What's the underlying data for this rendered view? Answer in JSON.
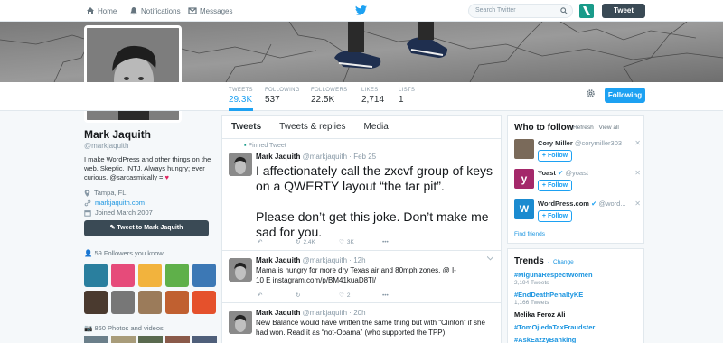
{
  "nav": {
    "home": "Home",
    "notifications": "Notifications",
    "messages": "Messages",
    "search_placeholder": "Search Twitter",
    "tweet": "Tweet"
  },
  "stats": [
    {
      "label": "TWEETS",
      "value": "29.3K"
    },
    {
      "label": "FOLLOWING",
      "value": "537"
    },
    {
      "label": "FOLLOWERS",
      "value": "22.5K"
    },
    {
      "label": "LIKES",
      "value": "2,714"
    },
    {
      "label": "LISTS",
      "value": "1"
    }
  ],
  "following_button": "Following",
  "profile": {
    "name": "Mark Jaquith",
    "handle": "@markjaquith",
    "bio": "I make WordPress and other things on the web. Skeptic. INTJ. Always hungry; ever curious. @sarcasmically =",
    "location": "Tampa, FL",
    "website": "markjaquith.com",
    "joined": "Joined March 2007",
    "tweet_to": "Tweet to Mark Jaquith",
    "followers_you_know": "59 Followers you know",
    "photos_videos": "860 Photos and videos"
  },
  "timeline": {
    "tabs": [
      "Tweets",
      "Tweets & replies",
      "Media"
    ],
    "tweets": [
      {
        "pinned_label": "Pinned Tweet",
        "name": "Mark Jaquith",
        "handle": "@markjaquith",
        "time": "Feb 25",
        "text1": "I affectionately call the zxcvf group of keys on a QWERTY layout “the tar pit”.",
        "text2": "Please don’t get this joke. Don’t make me sad for you.",
        "retweets": "2.4K",
        "likes": "3K"
      },
      {
        "name": "Mark Jaquith",
        "handle": "@markjaquith",
        "time": "12h",
        "text": "Mama is hungry for more dry Texas air and 80mph zones. @ I-10 E instagram.com/p/BM41kuaD8Tl/",
        "retweets": "",
        "likes": "2"
      },
      {
        "name": "Mark Jaquith",
        "handle": "@markjaquith",
        "time": "20h",
        "text": "New Balance would have written the same thing but with “Clinton” if she had won. Read it as “not-Obama” (who supported the TPP)."
      }
    ]
  },
  "who_to_follow": {
    "title": "Who to follow",
    "refresh": "Refresh",
    "view_all": "View all",
    "follow_label": "Follow",
    "find_friends": "Find friends",
    "suggestions": [
      {
        "name": "Cory Miller",
        "handle": "@corymiller303"
      },
      {
        "name": "Yoast",
        "handle": "@yoast"
      },
      {
        "name": "WordPress.com",
        "handle": "@word..."
      }
    ]
  },
  "trends": {
    "title": "Trends",
    "change": "Change",
    "items": [
      {
        "name": "#MigunaRespectWomen",
        "count": "2,194 Tweets"
      },
      {
        "name": "#EndDeathPenaltyKE",
        "count": "1,166 Tweets"
      },
      {
        "name": "Melika Feroz Ali",
        "count": ""
      },
      {
        "name": "#TomOjiedaTaxFraudster",
        "count": ""
      },
      {
        "name": "#AskEazzyBanking",
        "count": ""
      }
    ]
  },
  "colors": {
    "accent": "#1da1f2",
    "dark_button": "#3a4a55",
    "heart": "#e0245e"
  }
}
